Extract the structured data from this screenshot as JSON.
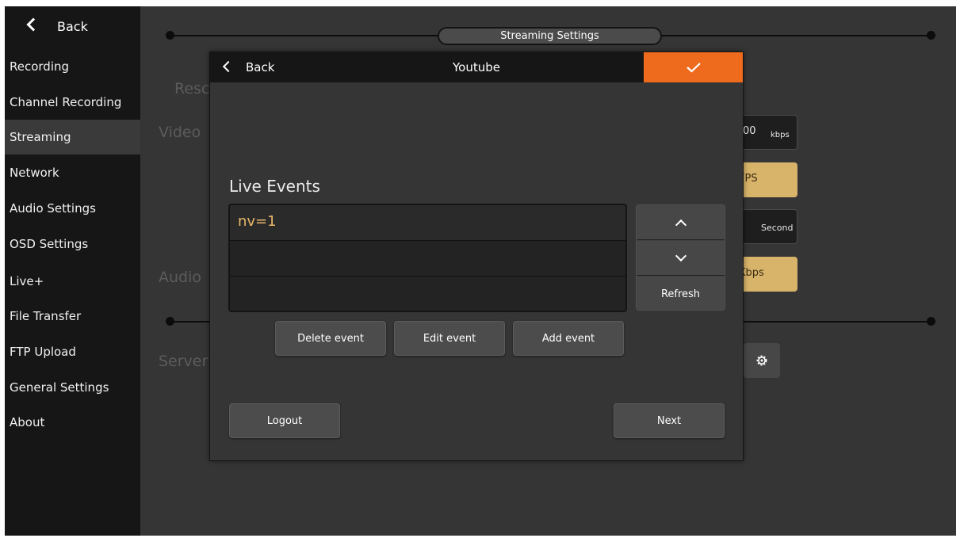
{
  "sidebar": {
    "back_label": "Back",
    "items": [
      {
        "label": "Recording"
      },
      {
        "label": "Channel Recording"
      },
      {
        "label": "Streaming",
        "active": true
      },
      {
        "label": "Network"
      },
      {
        "label": "Audio Settings"
      },
      {
        "label": "OSD Settings"
      },
      {
        "label": "Live+"
      },
      {
        "label": "File Transfer"
      },
      {
        "label": "FTP Upload"
      },
      {
        "label": "General Settings"
      },
      {
        "label": "About"
      }
    ]
  },
  "background": {
    "section_title": "Streaming Settings",
    "labels": {
      "resolution": "Resc",
      "video": "Video",
      "audio": "Audio",
      "server": "Server"
    },
    "fields": {
      "bitrate_value": "00",
      "bitrate_unit": "kbps",
      "fps_value": "FPS",
      "interval_unit": "Second",
      "audio_bitrate": "Kbps"
    },
    "settings_icon": "gear-icon"
  },
  "modal": {
    "back_label": "Back",
    "title": "Youtube",
    "confirm_icon": "checkmark-icon",
    "live_events_title": "Live Events",
    "events": [
      "nv=1",
      "",
      ""
    ],
    "scroll_up_icon": "chevron-up-icon",
    "scroll_down_icon": "chevron-down-icon",
    "refresh_label": "Refresh",
    "delete_label": "Delete event",
    "edit_label": "Edit event",
    "add_label": "Add event",
    "logout_label": "Logout",
    "next_label": "Next"
  },
  "colors": {
    "accent_orange": "#ee6a1c",
    "gold_field": "#d8b36a",
    "event_text": "#e8b86a",
    "sidebar_bg": "#161616",
    "content_bg": "#353535"
  }
}
